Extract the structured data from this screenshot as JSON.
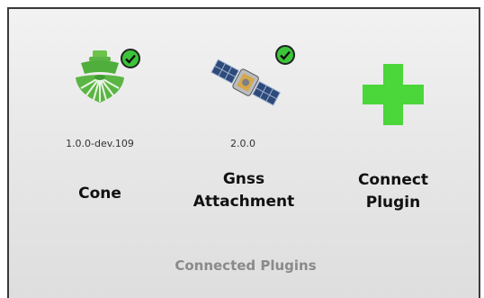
{
  "plugins": [
    {
      "name": "Cone",
      "version": "1.0.0-dev.109",
      "status": "connected",
      "icon": "cone-sprayer-icon"
    },
    {
      "name_line1": "Gnss",
      "name_line2": "Attachment",
      "version": "2.0.0",
      "status": "connected",
      "icon": "satellite-icon"
    }
  ],
  "connect": {
    "line1": "Connect",
    "line2": "Plugin",
    "icon": "plus-icon"
  },
  "footer": {
    "title": "Connected Plugins"
  },
  "colors": {
    "accent_green": "#4bd63a",
    "check_green": "#3cc43a",
    "cone_green": "#5bb544"
  }
}
